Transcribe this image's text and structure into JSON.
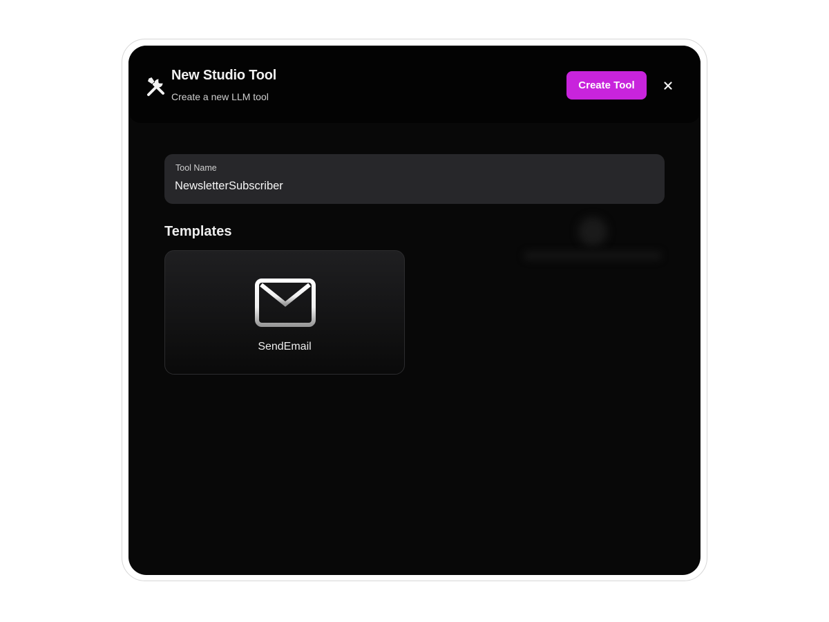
{
  "header": {
    "title": "New Studio Tool",
    "subtitle": "Create a new LLM tool",
    "create_button_label": "Create Tool",
    "icon": "tools-icon",
    "close_icon": "close-icon"
  },
  "form": {
    "tool_name_label": "Tool Name",
    "tool_name_value": "NewsletterSubscriber"
  },
  "templates": {
    "section_title": "Templates",
    "items": [
      {
        "label": "SendEmail",
        "icon": "mail-icon"
      }
    ]
  },
  "colors": {
    "accent": "#c824dc",
    "background": "#080808",
    "surface": "#27272a"
  }
}
